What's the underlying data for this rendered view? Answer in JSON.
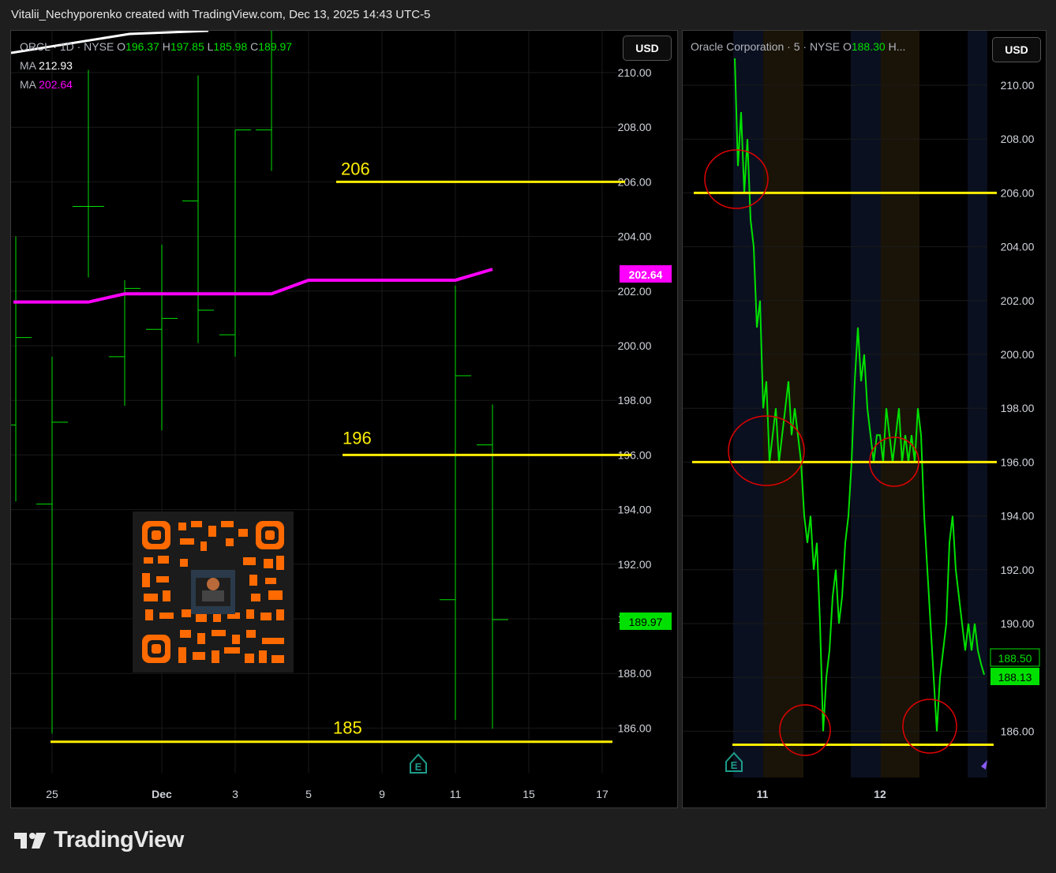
{
  "header": {
    "text": "Vitalii_Nechyporenko created with TradingView.com, Dec 13, 2025 14:43 UTC-5"
  },
  "brand": {
    "name": "TradingView",
    "icon": "tradingview-logo-icon"
  },
  "colors": {
    "up": "#00e000",
    "ma": "#ff00ff",
    "level": "#ffee00",
    "circle": "#e00000",
    "background": "#000000"
  },
  "left_panel": {
    "legend": {
      "symbol": "ORCL · 1D · NYSE",
      "open_label": "O",
      "open": "196.37",
      "high_label": "H",
      "high": "197.85",
      "low_label": "L",
      "low": "185.98",
      "close_label": "C",
      "close": "189.97",
      "ma1_label": "MA",
      "ma1_value": "212.93",
      "ma2_label": "MA",
      "ma2_value": "202.64"
    },
    "currency": "USD",
    "ma_badge": "202.64",
    "price_badge": "189.97",
    "level_labels": [
      "206",
      "196",
      "185"
    ],
    "earnings_marker": "E",
    "qr_code": "qr-code-icon"
  },
  "right_panel": {
    "legend": {
      "title": "Oracle Corporation · 5 · NYSE",
      "open_label": "O",
      "open": "188.30",
      "more": "H..."
    },
    "currency": "USD",
    "price_badge_1": "188.50",
    "price_badge_2": "188.13",
    "earnings_marker": "E"
  },
  "chart_data": [
    {
      "type": "ohlc",
      "title": "ORCL · 1D · NYSE",
      "ylim": [
        184.5,
        211.5
      ],
      "y_ticks": [
        "210.00",
        "208.00",
        "206.00",
        "204.00",
        "202.00",
        "200.00",
        "198.00",
        "196.00",
        "194.00",
        "192.00",
        "190.00",
        "188.00",
        "186.00"
      ],
      "x_tick_labels": [
        "25",
        "Dec",
        "3",
        "5",
        "9",
        "11",
        "15",
        "17"
      ],
      "bars": [
        {
          "date": "Nov 24",
          "open": 197.1,
          "high": 204.0,
          "low": 194.3,
          "close": 200.3
        },
        {
          "date": "Nov 25",
          "open": 194.2,
          "high": 199.6,
          "low": 185.8,
          "close": 197.2
        },
        {
          "date": "Nov 26",
          "open": 205.1,
          "high": 210.1,
          "low": 202.5,
          "close": 205.1
        },
        {
          "date": "Nov 28",
          "open": 199.6,
          "high": 202.4,
          "low": 197.8,
          "close": 202.1
        },
        {
          "date": "Dec 1",
          "open": 200.6,
          "high": 203.7,
          "low": 196.9,
          "close": 201.0
        },
        {
          "date": "Dec 2",
          "open": 205.3,
          "high": 209.9,
          "low": 200.1,
          "close": 201.3
        },
        {
          "date": "Dec 3",
          "open": 200.4,
          "high": 207.9,
          "low": 199.6,
          "close": 207.9
        },
        {
          "date": "Dec 4",
          "open": 207.9,
          "high": 214.0,
          "low": 206.4,
          "close": 214.0
        },
        {
          "date": "Dec 10",
          "open": 190.7,
          "high": 202.2,
          "low": 186.3,
          "close": 198.9
        },
        {
          "date": "Dec 11",
          "open": 196.37,
          "high": 197.85,
          "low": 185.98,
          "close": 189.97
        }
      ],
      "ma_line": [
        {
          "date": "Nov 23",
          "value": 201.6
        },
        {
          "date": "Nov 25",
          "value": 201.6
        },
        {
          "date": "Nov 26",
          "value": 201.6
        },
        {
          "date": "Nov 28",
          "value": 201.9
        },
        {
          "date": "Dec 1",
          "value": 201.9
        },
        {
          "date": "Dec 3",
          "value": 201.9
        },
        {
          "date": "Dec 4",
          "value": 201.9
        },
        {
          "date": "Dec 5",
          "value": 202.4
        },
        {
          "date": "Dec 10",
          "value": 202.4
        },
        {
          "date": "Dec 11",
          "value": 202.8
        }
      ],
      "levels": [
        206,
        196,
        185.5
      ]
    },
    {
      "type": "line",
      "title": "Oracle Corporation · 5 · NYSE",
      "ylim": [
        184.8,
        211
      ],
      "y_ticks": [
        "210.00",
        "208.00",
        "206.00",
        "204.00",
        "202.00",
        "200.00",
        "198.00",
        "196.00",
        "194.00",
        "192.00",
        "190.00",
        "188.00",
        "186.00"
      ],
      "x_tick_labels": [
        "11",
        "12"
      ],
      "values": [
        211,
        207,
        209,
        206,
        208,
        205,
        204,
        201,
        202,
        198,
        199,
        196,
        197,
        198,
        196,
        197,
        198,
        199,
        197,
        198,
        197,
        196,
        194,
        193,
        194,
        192,
        193,
        190,
        186,
        188,
        189,
        191,
        192,
        190,
        191,
        193,
        194,
        196,
        199,
        201,
        199,
        200,
        198,
        197,
        196,
        197,
        197,
        196,
        198,
        197,
        196,
        197,
        198,
        196,
        197,
        196,
        197,
        196,
        198,
        197,
        194,
        192,
        190,
        188,
        186,
        188,
        189,
        190,
        193,
        194,
        192,
        191,
        190,
        189,
        190,
        189,
        190,
        189,
        188.5,
        188.1
      ],
      "levels": [
        206,
        196,
        185.5
      ]
    }
  ]
}
